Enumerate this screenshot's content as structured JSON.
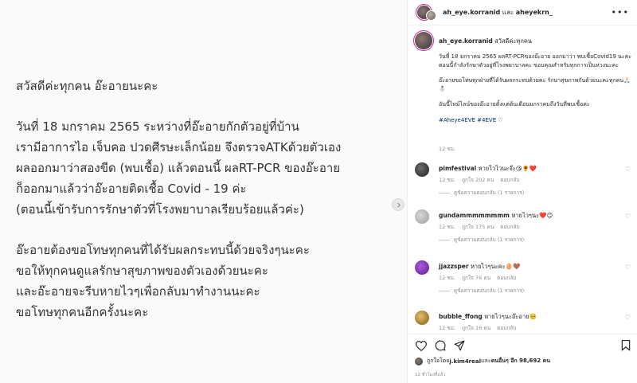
{
  "post_image": {
    "lines_1": [
      "สวัสดีค่ะทุกคน อ๊ะอายนะคะ"
    ],
    "lines_2": [
      "วันที่ 18 มกราคม 2565 ระหว่างที่อ๊ะอายกักตัวอยู่ที่บ้าน",
      "เรามีอาการไอ เจ็บคอ ปวดศีรษะเล็กน้อย จึงตรวจATKด้วยตัวเอง",
      "ผลออกมาว่าสองขีด (พบเชื้อ) แล้วตอนนี้ ผลRT-PCR ของอ๊ะอาย",
      "ก็ออกมาแล้วว่าอ๊ะอายติดเชื้อ Covid - 19 ค่ะ",
      "(ตอนนี้เข้ารับการรักษาตัวที่โรงพยาบาลเรียบร้อยแล้วค่ะ)"
    ],
    "lines_3": [
      "อ๊ะอายต้องขอโทษทุกคนที่ได้รับผลกระทบนี้ด้วยจริงๆนะคะ",
      "ขอให้ทุกคนดูแลรักษาสุขภาพของตัวเองด้วยนะคะ",
      "และอ๊ะอายจะรีบหายไวๆเพื่อกลับมาทำงานนะคะ",
      "ขอโทษทุกคนอีกครั้งนะคะ"
    ],
    "next_icon": "chevron-right-icon"
  },
  "header": {
    "user": "ah_eye.korranid",
    "connector": " และ ",
    "collaborator": "aheyekrn_",
    "more_icon": "more-horizontal-icon"
  },
  "caption": {
    "user": "ah_eye.korranid",
    "greeting": "สวัสดีค่ะทุกคน",
    "para1": "วันที่ 18 มกราคม 2565 ผลRT-PCRของอ๊ะอาย ออกมาว่า พบเชื้อCovid19 นะคะ ตอนนี้กำลังรักษาตัวอยู่ที่โรงพยาบาลคะ ขอบคุณสำหรับทุกการเป็นห่วงนะคะ",
    "para2": "อ๊ะอายขอโทษทุกฝ่ายที่ได้รับผลกระทบด้วยคะ รักษาสุขภาพกันด้วยนะคะทุกคน🙏🏻⛄",
    "para3": "อันนี้ไทม์ไลน์ของอ๊ะอายตั้งแต่ต้นเดือนมกราคมถึงวันที่พบเชื้อค่ะ",
    "tags": "#Aheye4EVE #4EVE",
    "time": "12 ชม."
  },
  "comments": [
    {
      "user": "pimfestival",
      "text": "หายไวไวนะจ๊ะ😘🌻❤️",
      "time": "12 ชม.",
      "likes": "ถูกใจ 202 คน",
      "reply": "ตอบกลับ",
      "replies": "ดูข้อความตอบกลับ (1 รายการ)"
    },
    {
      "user": "gundammmmmmmm",
      "text": "หายไวๆนะ❤️😊",
      "time": "12 ชม.",
      "likes": "ถูกใจ 175 คน",
      "reply": "ตอบกลับ",
      "replies": "ดูข้อความตอบกลับ (1 รายการ)"
    },
    {
      "user": "jjazzsper",
      "text": "หายไวๆนะคะ🥚🤎",
      "time": "12 ชม.",
      "likes": "ถูกใจ 76 คน",
      "reply": "ตอบกลับ",
      "replies": "ดูข้อความตอบกลับ (1 รายการ)"
    },
    {
      "user": "bubble_ffong",
      "text": "หายไวๆนะอ๊ะอาย🥺",
      "time": "12 ชม.",
      "likes": "ถูกใจ 16 คน",
      "reply": "ตอบกลับ",
      "replies": ""
    }
  ],
  "actions": {
    "like_icon": "heart-icon",
    "comment_icon": "comment-icon",
    "share_icon": "share-icon",
    "save_icon": "bookmark-icon"
  },
  "likes": {
    "prefix": "ถูกใจโดย ",
    "user": "j.kim4real",
    "middle": " และ ",
    "others": "คนอื่นๆ อีก 98,692 คน"
  },
  "post_date": "12 ชั่วโมงที่แล้ว",
  "colors": {
    "link": "#00376b",
    "muted": "#8e8e8e",
    "ring": "#d6249f"
  }
}
